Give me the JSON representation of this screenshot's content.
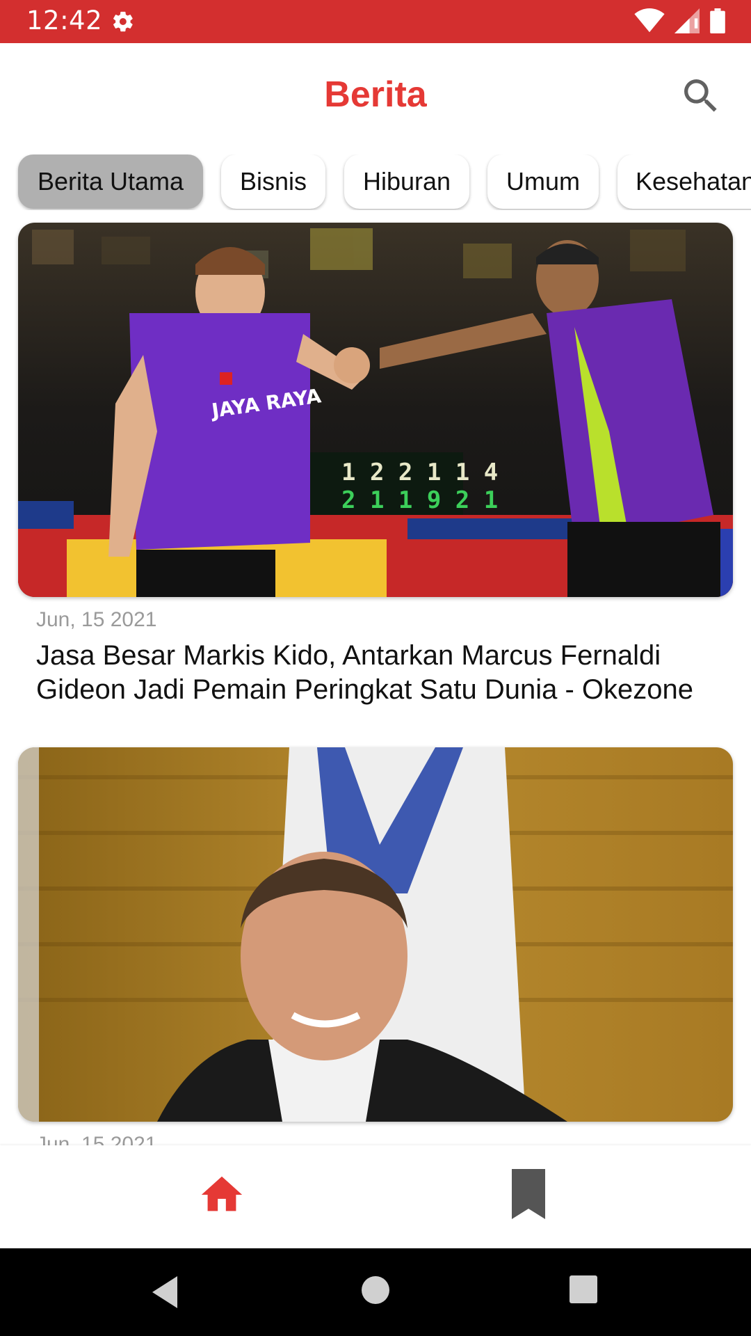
{
  "status_bar": {
    "time": "12:42"
  },
  "app_bar": {
    "title": "Berita"
  },
  "chips": [
    {
      "label": "Berita Utama",
      "selected": true
    },
    {
      "label": "Bisnis",
      "selected": false
    },
    {
      "label": "Hiburan",
      "selected": false
    },
    {
      "label": "Umum",
      "selected": false
    },
    {
      "label": "Kesehatan",
      "selected": false
    }
  ],
  "articles": [
    {
      "date": "Jun, 15 2021",
      "title": "Jasa Besar Markis Kido, Antarkan Marcus Fernaldi Gideon Jadi Pemain Peringkat Satu Dunia - Okezone",
      "image": "badminton-players-photo",
      "scoreboard": [
        "1 2 2 1 1 4",
        "2 1 1 9 2 1"
      ],
      "shirt_text": "JAYA RAYA"
    },
    {
      "date": "Jun, 15 2021",
      "title": "",
      "image": "man-with-flag-photo"
    }
  ],
  "bottom_nav": [
    {
      "icon": "home-icon",
      "active": true
    },
    {
      "icon": "bookmark-icon",
      "active": false
    }
  ],
  "colors": {
    "accent": "#e53935",
    "status_bar": "#d32f2f",
    "chip_selected": "#b0b0b0"
  }
}
